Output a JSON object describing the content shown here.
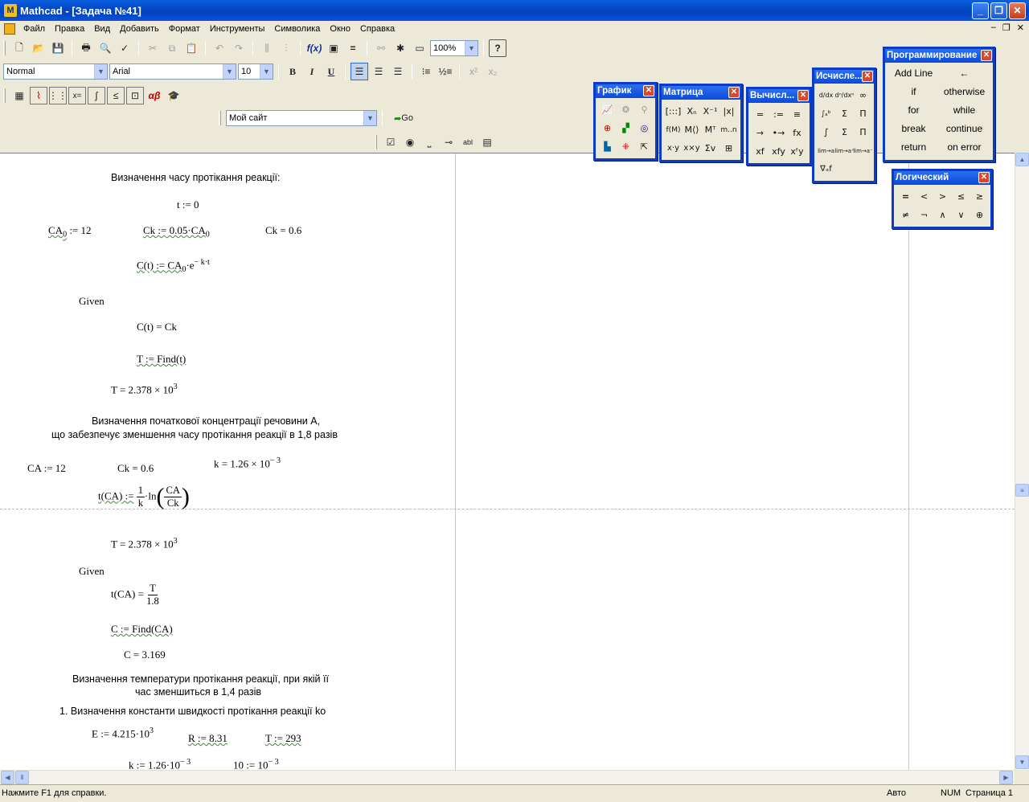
{
  "window": {
    "title": "Mathcad - [Задача №41]",
    "app_icon": "mathcad-icon"
  },
  "menu": [
    "Файл",
    "Правка",
    "Вид",
    "Добавить",
    "Формат",
    "Инструменты",
    "Символика",
    "Окно",
    "Справка"
  ],
  "toolbar": {
    "zoom": "100%",
    "style": "Normal",
    "font": "Arial",
    "size": "10",
    "url": "Мой сайт",
    "go": "Go"
  },
  "doc": {
    "h1": "Визначення часу протікання реакції:",
    "t_def": "t := 0",
    "ca0_def": "CA",
    "ca0_sub": "0",
    "ca0_val": " := 12",
    "ck_def": "Ck := 0.05·CA",
    "ck_sub": "0",
    "ck_eval": "Ck = 0.6",
    "c_def_a": "C(t) := CA",
    "c_def_sub": "0",
    "c_def_b": "·e",
    "c_def_exp": "− k·t",
    "given1": "Given",
    "eq1": "C(t) = Ck",
    "find1": "T := Find(t)",
    "tres1_a": "T = 2.378 × 10",
    "tres1_exp": "3",
    "h2_line1": "Визначення початкової концентрації речовини А,",
    "h2_line2": "що забезпечує зменшення часу протікання реакції в 1,8 разів",
    "ca_def": "CA := 12",
    "ck2": "Ck = 0.6",
    "k_def_a": "k = 1.26 × 10",
    "k_def_exp": "− 3",
    "tca_def": "t(CA) :=",
    "tca_num": "1",
    "tca_den": "k",
    "tca_ln": "·ln",
    "tca_in_num": "CA",
    "tca_in_den": "Ck",
    "tres2_a": "T = 2.378 × 10",
    "tres2_exp": "3",
    "given2": "Given",
    "eq2_a": "t(CA) =",
    "eq2_num": "T",
    "eq2_den": "1.8",
    "find2": "C := Find(CA)",
    "cres": "C = 3.169",
    "h3_line1": "Визначення температури протікання реакції, при якій її",
    "h3_line2": "час зменшиться в 1,4 разів",
    "h4": "1. Визначення константи швидкості протікання реакції ko",
    "e_def_a": "E := 4.215·10",
    "e_def_exp": "3",
    "r_def": "R := 8.31",
    "t293": "T := 293",
    "k_cut_a": "k := 1.26·10",
    "k_cut_exp": "− 3",
    "k_cut2_a": "10 :=  10",
    "k_cut2_exp": "− 3"
  },
  "status": {
    "help": "Нажмите F1 для справки.",
    "mode": "Авто",
    "num": "NUM",
    "page": "Страница 1"
  },
  "palettes": {
    "graph": {
      "title": "График",
      "icons": [
        "xy-plot-icon",
        "polar-plot-icon",
        "surface-plot-icon",
        "contour-plot-icon",
        "3d-scatter-icon",
        "3d-bar-icon",
        "vector-field-icon",
        "zoom-icon",
        "trace-icon"
      ]
    },
    "matrix": {
      "title": "Матрица",
      "buttons": [
        "[:::]",
        "Xₙ",
        "X⁻¹",
        "|x|",
        "f(M)",
        "M⟨⟩",
        "Mᵀ",
        "m..n",
        "x·y",
        "x×y",
        "Σv",
        "⊞"
      ]
    },
    "evaluate": {
      "title": "Вычисл...",
      "buttons": [
        "=",
        ":=",
        "≡",
        "→",
        "•→",
        "fx",
        "xf",
        "xfy",
        "xᶠy"
      ]
    },
    "calculus": {
      "title": "Исчисле...",
      "buttons": [
        "d/dx",
        "dⁿ/dxⁿ",
        "∞",
        "∫ₐᵇ",
        "Σ",
        "Π",
        "∫",
        "Σ",
        "Π",
        "lim→a",
        "lim→a⁺",
        "lim→a⁻",
        "∇ₓf"
      ]
    },
    "programming": {
      "title": "Программирование",
      "buttons": [
        "Add Line",
        "←",
        "if",
        "otherwise",
        "for",
        "while",
        "break",
        "continue",
        "return",
        "on error"
      ]
    },
    "boolean": {
      "title": "Логический",
      "buttons": [
        "=",
        "<",
        ">",
        "≤",
        "≥",
        "≠",
        "¬",
        "∧",
        "∨",
        "⊕"
      ]
    }
  }
}
